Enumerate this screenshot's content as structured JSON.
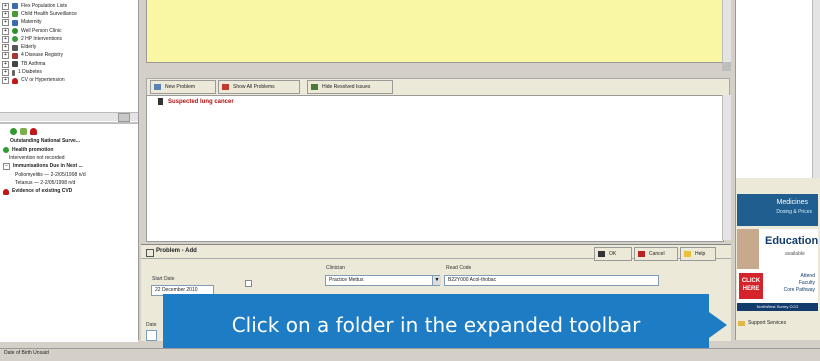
{
  "left_tree": {
    "items": [
      {
        "label": "Flex Population Lists",
        "icon": "list-icon"
      },
      {
        "label": "Child Health Surveillance",
        "icon": "child-icon"
      },
      {
        "label": "Maternity",
        "icon": "maternity-icon"
      },
      {
        "label": "Well Person Clinic",
        "icon": "clinic-icon"
      },
      {
        "label": "2 HP Interventions",
        "icon": "intervention-icon"
      },
      {
        "label": "Elderly",
        "icon": "elderly-icon"
      },
      {
        "label": "4 Disease Registry",
        "icon": "registry-icon"
      },
      {
        "label": "TB Asthma",
        "icon": "asthma-icon"
      },
      {
        "label": "1 Diabetes",
        "icon": "diabetes-icon"
      },
      {
        "label": "CV or Hypertension",
        "icon": "heart-icon"
      }
    ]
  },
  "alerts": {
    "title": "Outstanding National Surve...",
    "items": [
      {
        "label": "Health promotion",
        "bold": true
      },
      {
        "label": "Intervention not recorded",
        "bold": false
      },
      {
        "label": "Immunisations Due in Next ...",
        "bold": true
      },
      {
        "label": "Poliomyelitis — 2-2/05/1998 n/d",
        "bold": false
      },
      {
        "label": "Tetanus — 2-2/05/1998 n/d",
        "bold": false
      },
      {
        "label": "Evidence of existing CVD",
        "bold": true
      }
    ]
  },
  "problems_toolbar": {
    "new_problem": "New Problem",
    "show_all": "Show All Problems",
    "hide_resolved": "Hide Resolved Issues"
  },
  "problem_list": {
    "item": "Suspected lung cancer"
  },
  "problem_add": {
    "title": "Problem - Add",
    "ok": "OK",
    "cancel": "Cancel",
    "help": "Help",
    "start_date_label": "Start Date",
    "start_date_value": "22 December 2010",
    "clinician_label": "Clinician",
    "clinician_value": "Practice Mettus",
    "read_code_label": "Read Code",
    "read_code_value": "B22Y000  Acol-thobac",
    "end_date_label": "Date"
  },
  "ad_panel": {
    "medicines_title": "Medicines",
    "medicines_sub": "Dosing & Prices",
    "education_title": "Education",
    "education_sub": "available",
    "click_line1": "CLICK",
    "click_line2": "HERE",
    "attend_text": "Attend\nFaculty\nCore Pathway",
    "footer_text": "NorthWest Surrey CCG",
    "support_label": "Support Services"
  },
  "tooltip": {
    "text": "Click on a folder in the expanded toolbar"
  },
  "status_bar": {
    "left": "Date of Birth Unsaid",
    "middle": "",
    "right": ""
  },
  "colors": {
    "yellow_panel": "#f9f6a4",
    "tooltip_bg": "#1d7cc4",
    "accent_red": "#b01010",
    "click_red": "#d4232a",
    "medicines_blue": "#1f5e8f"
  }
}
